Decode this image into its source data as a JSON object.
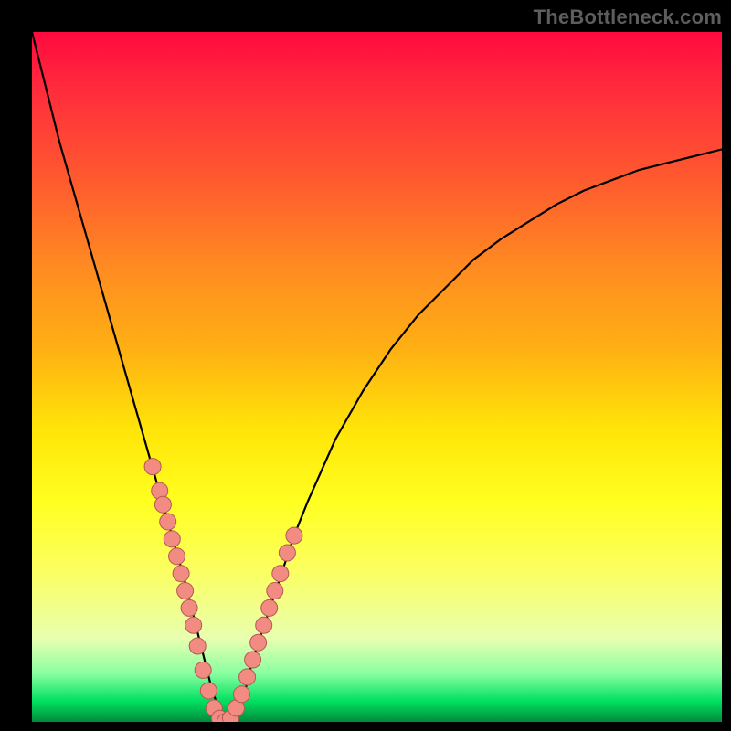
{
  "watermark": "TheBottleneck.com",
  "colors": {
    "curve": "#000000",
    "dot_fill": "#f28b82",
    "dot_stroke": "#b35a53",
    "background_black": "#000000"
  },
  "chart_data": {
    "type": "line",
    "title": "",
    "xlabel": "",
    "ylabel": "",
    "xlim": [
      0,
      100
    ],
    "ylim": [
      0,
      100
    ],
    "series": [
      {
        "name": "bottleneck-curve",
        "x": [
          0,
          2,
          4,
          6,
          8,
          10,
          12,
          14,
          16,
          18,
          20,
          22,
          23,
          24,
          25,
          26,
          27,
          28,
          29,
          30,
          31,
          32,
          34,
          36,
          38,
          40,
          44,
          48,
          52,
          56,
          60,
          64,
          68,
          72,
          76,
          80,
          84,
          88,
          92,
          96,
          100
        ],
        "y": [
          100,
          92,
          84,
          77,
          70,
          63,
          56,
          49,
          42,
          35,
          28,
          21,
          17,
          13,
          9,
          5,
          2,
          0,
          0,
          2,
          5,
          9,
          15,
          21,
          27,
          32,
          41,
          48,
          54,
          59,
          63,
          67,
          70,
          72.5,
          75,
          77,
          78.5,
          80,
          81,
          82,
          83
        ]
      }
    ],
    "scatter_points": {
      "name": "sample-dots",
      "x": [
        17.5,
        18.5,
        19.0,
        19.7,
        20.3,
        21.0,
        21.6,
        22.2,
        22.8,
        23.4,
        24.0,
        24.8,
        25.6,
        26.4,
        27.2,
        28.0,
        28.8,
        29.6,
        30.4,
        31.2,
        32.0,
        32.8,
        33.6,
        34.4,
        35.2,
        36.0,
        37.0,
        38.0
      ],
      "y": [
        37.0,
        33.5,
        31.5,
        29.0,
        26.5,
        24.0,
        21.5,
        19.0,
        16.5,
        14.0,
        11.0,
        7.5,
        4.5,
        2.0,
        0.5,
        0.0,
        0.5,
        2.0,
        4.0,
        6.5,
        9.0,
        11.5,
        14.0,
        16.5,
        19.0,
        21.5,
        24.5,
        27.0
      ]
    },
    "gradient_stops": [
      {
        "pos": 0.0,
        "color": "#ff0a3e"
      },
      {
        "pos": 0.08,
        "color": "#ff2a3c"
      },
      {
        "pos": 0.22,
        "color": "#ff5c2e"
      },
      {
        "pos": 0.35,
        "color": "#ff8e20"
      },
      {
        "pos": 0.46,
        "color": "#ffb013"
      },
      {
        "pos": 0.58,
        "color": "#ffe608"
      },
      {
        "pos": 0.68,
        "color": "#ffff20"
      },
      {
        "pos": 0.78,
        "color": "#fbff60"
      },
      {
        "pos": 0.88,
        "color": "#e8ffb0"
      },
      {
        "pos": 0.93,
        "color": "#88ffa0"
      },
      {
        "pos": 0.97,
        "color": "#00e060"
      },
      {
        "pos": 1.0,
        "color": "#008a3a"
      }
    ]
  }
}
